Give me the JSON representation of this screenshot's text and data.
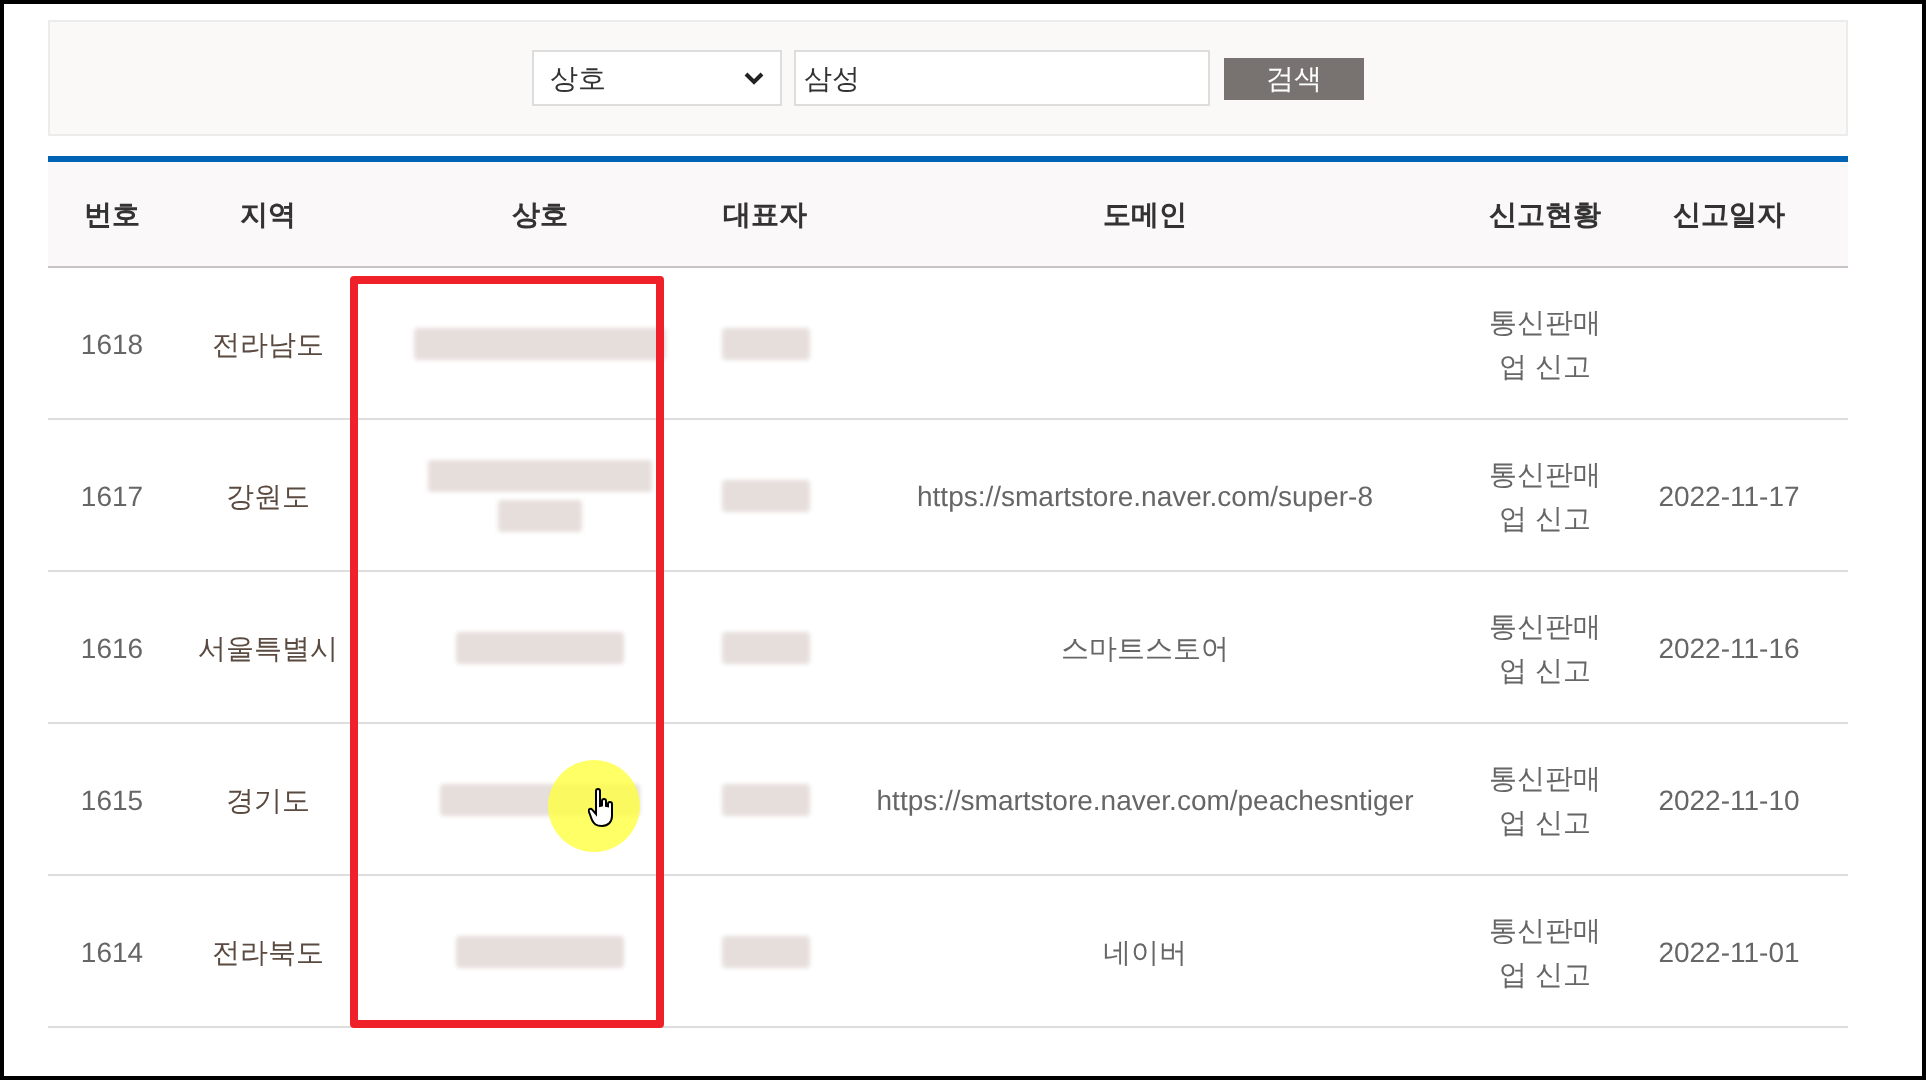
{
  "search": {
    "field_select": "상호",
    "query": "삼성",
    "button": "검색"
  },
  "table": {
    "columns": [
      "번호",
      "지역",
      "상호",
      "대표자",
      "도메인",
      "신고현황",
      "신고일자"
    ],
    "rows": [
      {
        "number": "1618",
        "region": "전라남도",
        "domain": "",
        "status": "통신판매업 신고",
        "date": ""
      },
      {
        "number": "1617",
        "region": "강원도",
        "domain": "https://smartstore.naver.com/super-8",
        "status": "통신판매업 신고",
        "date": "2022-11-17"
      },
      {
        "number": "1616",
        "region": "서울특별시",
        "domain": "스마트스토어",
        "status": "통신판매업 신고",
        "date": "2022-11-16"
      },
      {
        "number": "1615",
        "region": "경기도",
        "domain": "https://smartstore.naver.com/peachesntiger",
        "status": "통신판매업 신고",
        "date": "2022-11-10"
      },
      {
        "number": "1614",
        "region": "전라북도",
        "domain": "네이버",
        "status": "통신판매업 신고",
        "date": "2022-11-01"
      }
    ]
  }
}
